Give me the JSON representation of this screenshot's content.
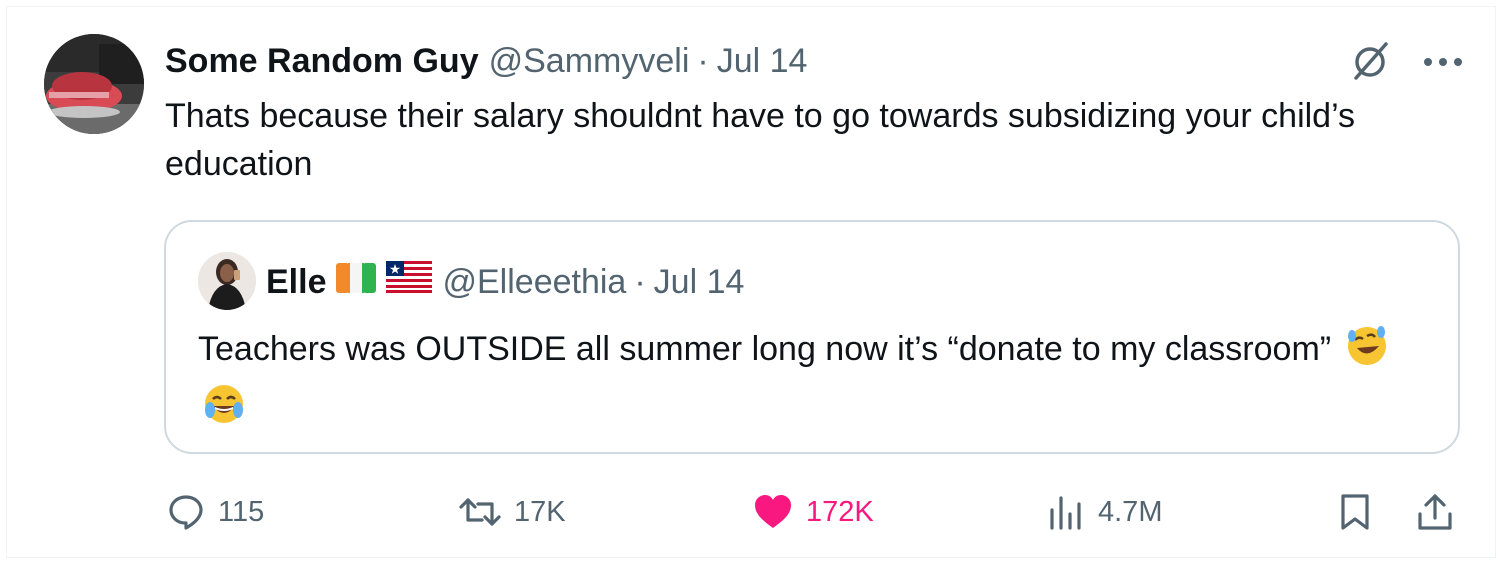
{
  "tweet": {
    "author_name": "Some Random Guy",
    "author_handle": "@Sammyveli",
    "separator": "·",
    "date": "Jul 14",
    "text": "Thats because their salary shouldnt have to go towards subsidizing your child’s education"
  },
  "quoted_tweet": {
    "author_name": "Elle",
    "author_handle": "@Elleeethia",
    "separator": "·",
    "date": "Jul 14",
    "text": "Teachers was OUTSIDE all summer long now it’s “donate to my classroom”",
    "flags": [
      "flag-ivory-coast",
      "flag-liberia"
    ],
    "emojis": [
      "rolling-on-floor-laughing-emoji",
      "tears-of-joy-emoji"
    ]
  },
  "actions": {
    "replies": "115",
    "reposts": "17K",
    "likes": "172K",
    "views": "4.7M"
  },
  "icons": {
    "top": [
      "grok-icon",
      "more-options-icon"
    ],
    "bottom": [
      "reply-icon",
      "repost-icon",
      "like-icon",
      "views-icon",
      "bookmark-icon",
      "share-icon"
    ]
  },
  "colors": {
    "text_primary": "#0f1419",
    "text_secondary": "#536471",
    "like_active": "#f91880",
    "border": "#cfd9de"
  }
}
